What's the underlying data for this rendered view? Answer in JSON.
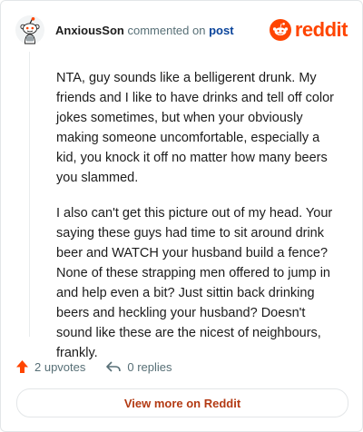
{
  "comment": {
    "username": "AnxiousSon",
    "action_text": "commented on",
    "post_link": "post",
    "paragraphs": [
      "NTA, guy sounds like a belligerent drunk. My friends and I like to have drinks and tell off color jokes sometimes, but when your obviously making someone uncomfortable, especially a kid, you knock it off no matter how many beers you slammed.",
      "I also can't get this picture out of my head. Your saying these guys had time to sit around drink beer and WATCH your husband build a fence? None of these strapping men offered to jump in and help even a bit? Just sittin back drinking beers and heckling your husband? Doesn't sound like these are the nicest of neighbours, frankly."
    ]
  },
  "brand": {
    "wordmark": "reddit",
    "color": "#ff4500"
  },
  "actions": {
    "upvotes": "2 upvotes",
    "replies": "0 replies"
  },
  "footer": {
    "view_more": "View more on Reddit"
  },
  "icons": {
    "avatar": "snoo-avatar-icon",
    "logo": "reddit-logo-icon",
    "upvote": "upvote-arrow-icon",
    "reply": "reply-arrow-icon"
  }
}
